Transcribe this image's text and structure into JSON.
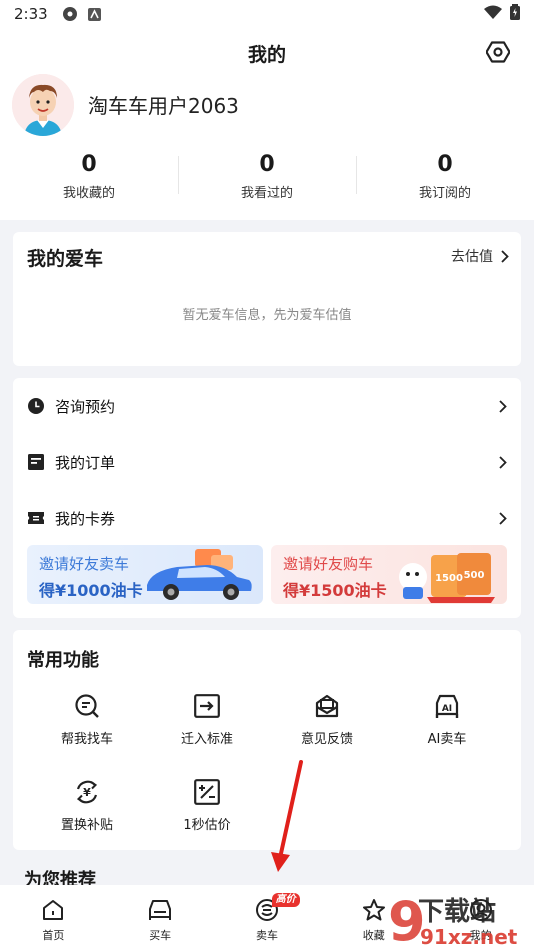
{
  "status_bar": {
    "time": "2:33"
  },
  "header": {
    "title": "我的"
  },
  "profile": {
    "username": "淘车车用户2063"
  },
  "stats": [
    {
      "value": "0",
      "label": "我收藏的"
    },
    {
      "value": "0",
      "label": "我看过的"
    },
    {
      "value": "0",
      "label": "我订阅的"
    }
  ],
  "my_car": {
    "title": "我的爱车",
    "action": "去估值",
    "empty_text": "暂无爱车信息，先为爱车估值"
  },
  "menu": [
    {
      "label": "咨询预约",
      "icon": "clock-icon"
    },
    {
      "label": "我的订单",
      "icon": "order-icon"
    },
    {
      "label": "我的卡券",
      "icon": "ticket-icon"
    }
  ],
  "banners": [
    {
      "line1": "邀请好友卖车",
      "line2": "得¥1000油卡"
    },
    {
      "line1": "邀请好友购车",
      "line2": "得¥1500油卡",
      "coupon_values": [
        "1500",
        "500"
      ]
    }
  ],
  "functions": {
    "title": "常用功能",
    "items": [
      {
        "label": "帮我找车",
        "icon": "search-car-icon"
      },
      {
        "label": "迁入标准",
        "icon": "move-in-icon"
      },
      {
        "label": "意见反馈",
        "icon": "feedback-icon"
      },
      {
        "label": "AI卖车",
        "icon": "ai-car-icon",
        "icon_text": "AI"
      },
      {
        "label": "置换补贴",
        "icon": "exchange-icon",
        "icon_text": "¥"
      },
      {
        "label": "1秒估价",
        "icon": "valuation-icon"
      }
    ]
  },
  "recommend": {
    "title": "为您推荐"
  },
  "tabbar": {
    "items": [
      {
        "label": "首页",
        "icon": "home-icon"
      },
      {
        "label": "买车",
        "icon": "car-icon"
      },
      {
        "label": "卖车",
        "icon": "sell-icon",
        "badge": "高价"
      },
      {
        "label": "收藏",
        "icon": "star-icon"
      },
      {
        "label": "我的",
        "icon": "profile-icon"
      }
    ]
  },
  "watermark": {
    "text1": "下载站",
    "text2": "91xz.net"
  },
  "colors": {
    "accent_red": "#e8322e",
    "blue": "#2a63c4",
    "bg": "#f2f3f7"
  }
}
